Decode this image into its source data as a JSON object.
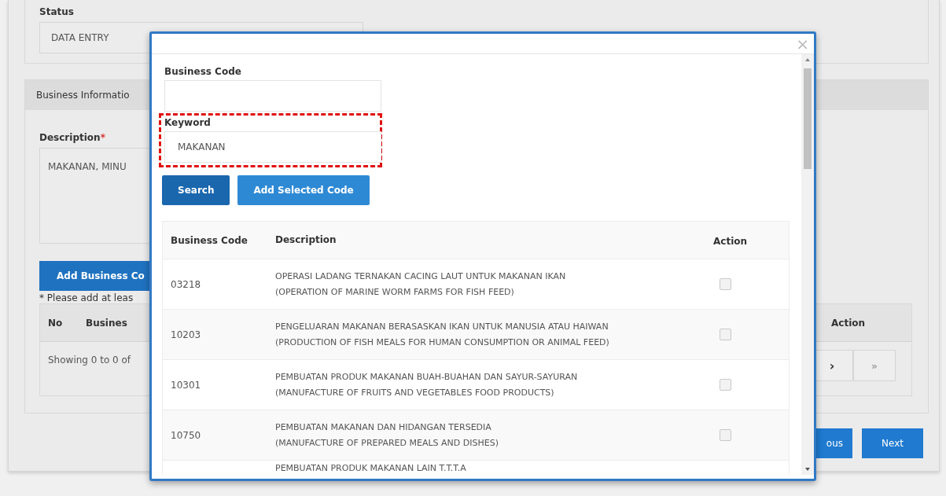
{
  "background_form": {
    "status": {
      "label": "Status",
      "value": "DATA ENTRY"
    },
    "section_title": "Business Informatio",
    "description": {
      "label": "Description",
      "required_mark": "*",
      "value": "MAKANAN, MINU"
    },
    "add_button": "Add Business Co",
    "note": "* Please add at leas",
    "table": {
      "columns": [
        "No",
        "Busines",
        "Action"
      ],
      "info": "Showing 0 to 0 of",
      "pagination": [
        "›",
        "»"
      ]
    },
    "buttons": [
      "ous",
      "Next"
    ]
  },
  "modal": {
    "close": "×",
    "fields": [
      {
        "label": "Business Code",
        "highlighted": false
      },
      {
        "label": "Keyword",
        "value": "MAKANAN",
        "highlighted": true
      }
    ],
    "buttons": [
      {
        "label": "Search",
        "kind": "primary"
      },
      {
        "label": "Add Selected Code",
        "kind": "secondary"
      }
    ],
    "table": {
      "columns": [
        "Business Code",
        "Description",
        "Action"
      ],
      "rows": [
        {
          "code": "03218",
          "description": [
            "OPERASI LADANG TERNAKAN CACING LAUT UNTUK MAKANAN IKAN",
            "(OPERATION OF MARINE WORM FARMS FOR FISH FEED)"
          ],
          "checked": false
        },
        {
          "code": "10203",
          "description": [
            "PENGELUARAN MAKANAN BERASASKAN IKAN UNTUK MANUSIA ATAU HAIWAN",
            "(PRODUCTION OF FISH MEALS FOR HUMAN CONSUMPTION OR ANIMAL FEED)"
          ],
          "checked": false
        },
        {
          "code": "10301",
          "description": [
            "PEMBUATAN PRODUK MAKANAN BUAH-BUAHAN DAN SAYUR-SAYURAN",
            "(MANUFACTURE OF FRUITS AND VEGETABLES FOOD PRODUCTS)"
          ],
          "checked": false
        },
        {
          "code": "10750",
          "description": [
            "PEMBUATAN MAKANAN DAN HIDANGAN TERSEDIA",
            "(MANUFACTURE OF PREPARED MEALS AND DISHES)"
          ],
          "checked": false
        }
      ],
      "partial_row": "PEMBUATAN PRODUK MAKANAN LAIN T.T.T.A"
    }
  }
}
